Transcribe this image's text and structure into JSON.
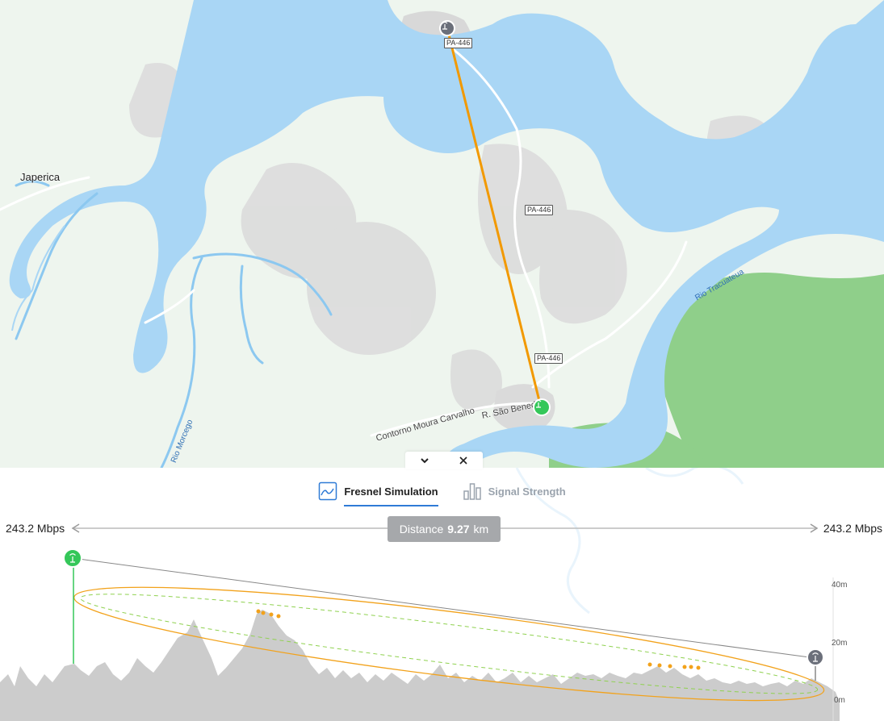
{
  "map": {
    "places": [
      {
        "name": "Japerica"
      }
    ],
    "road_shields": [
      "PA-446",
      "PA-446",
      "PA-446"
    ],
    "roads": [
      "Contorno Moura Carvalho",
      "R. São Benedito"
    ],
    "rivers": [
      "Rio Tracuateua",
      "Rio Morcego"
    ],
    "endpoints": [
      {
        "role": "access-point",
        "status_color": "#6b6f7a"
      },
      {
        "role": "station",
        "status_color": "#34c759"
      }
    ],
    "link_color": "#f29900"
  },
  "panel_controls": {
    "collapse_icon": "chevron-down-icon",
    "close_icon": "close-icon"
  },
  "tabs": [
    {
      "label": "Fresnel Simulation",
      "icon": "fresnel-chart-icon",
      "active": true
    },
    {
      "label": "Signal Strength",
      "icon": "bar-chart-icon",
      "active": false
    }
  ],
  "link": {
    "left_rate": "243.2 Mbps",
    "right_rate": "243.2 Mbps",
    "distance_label": "Distance",
    "distance_value": "9.27",
    "distance_unit": "km"
  },
  "profile": {
    "y_axis_labels": [
      "40m",
      "20m",
      "0m"
    ],
    "accent_color": "#f2a21b",
    "fresnel_inner_color": "#8fd14f",
    "terrain_color": "#cccccc"
  }
}
